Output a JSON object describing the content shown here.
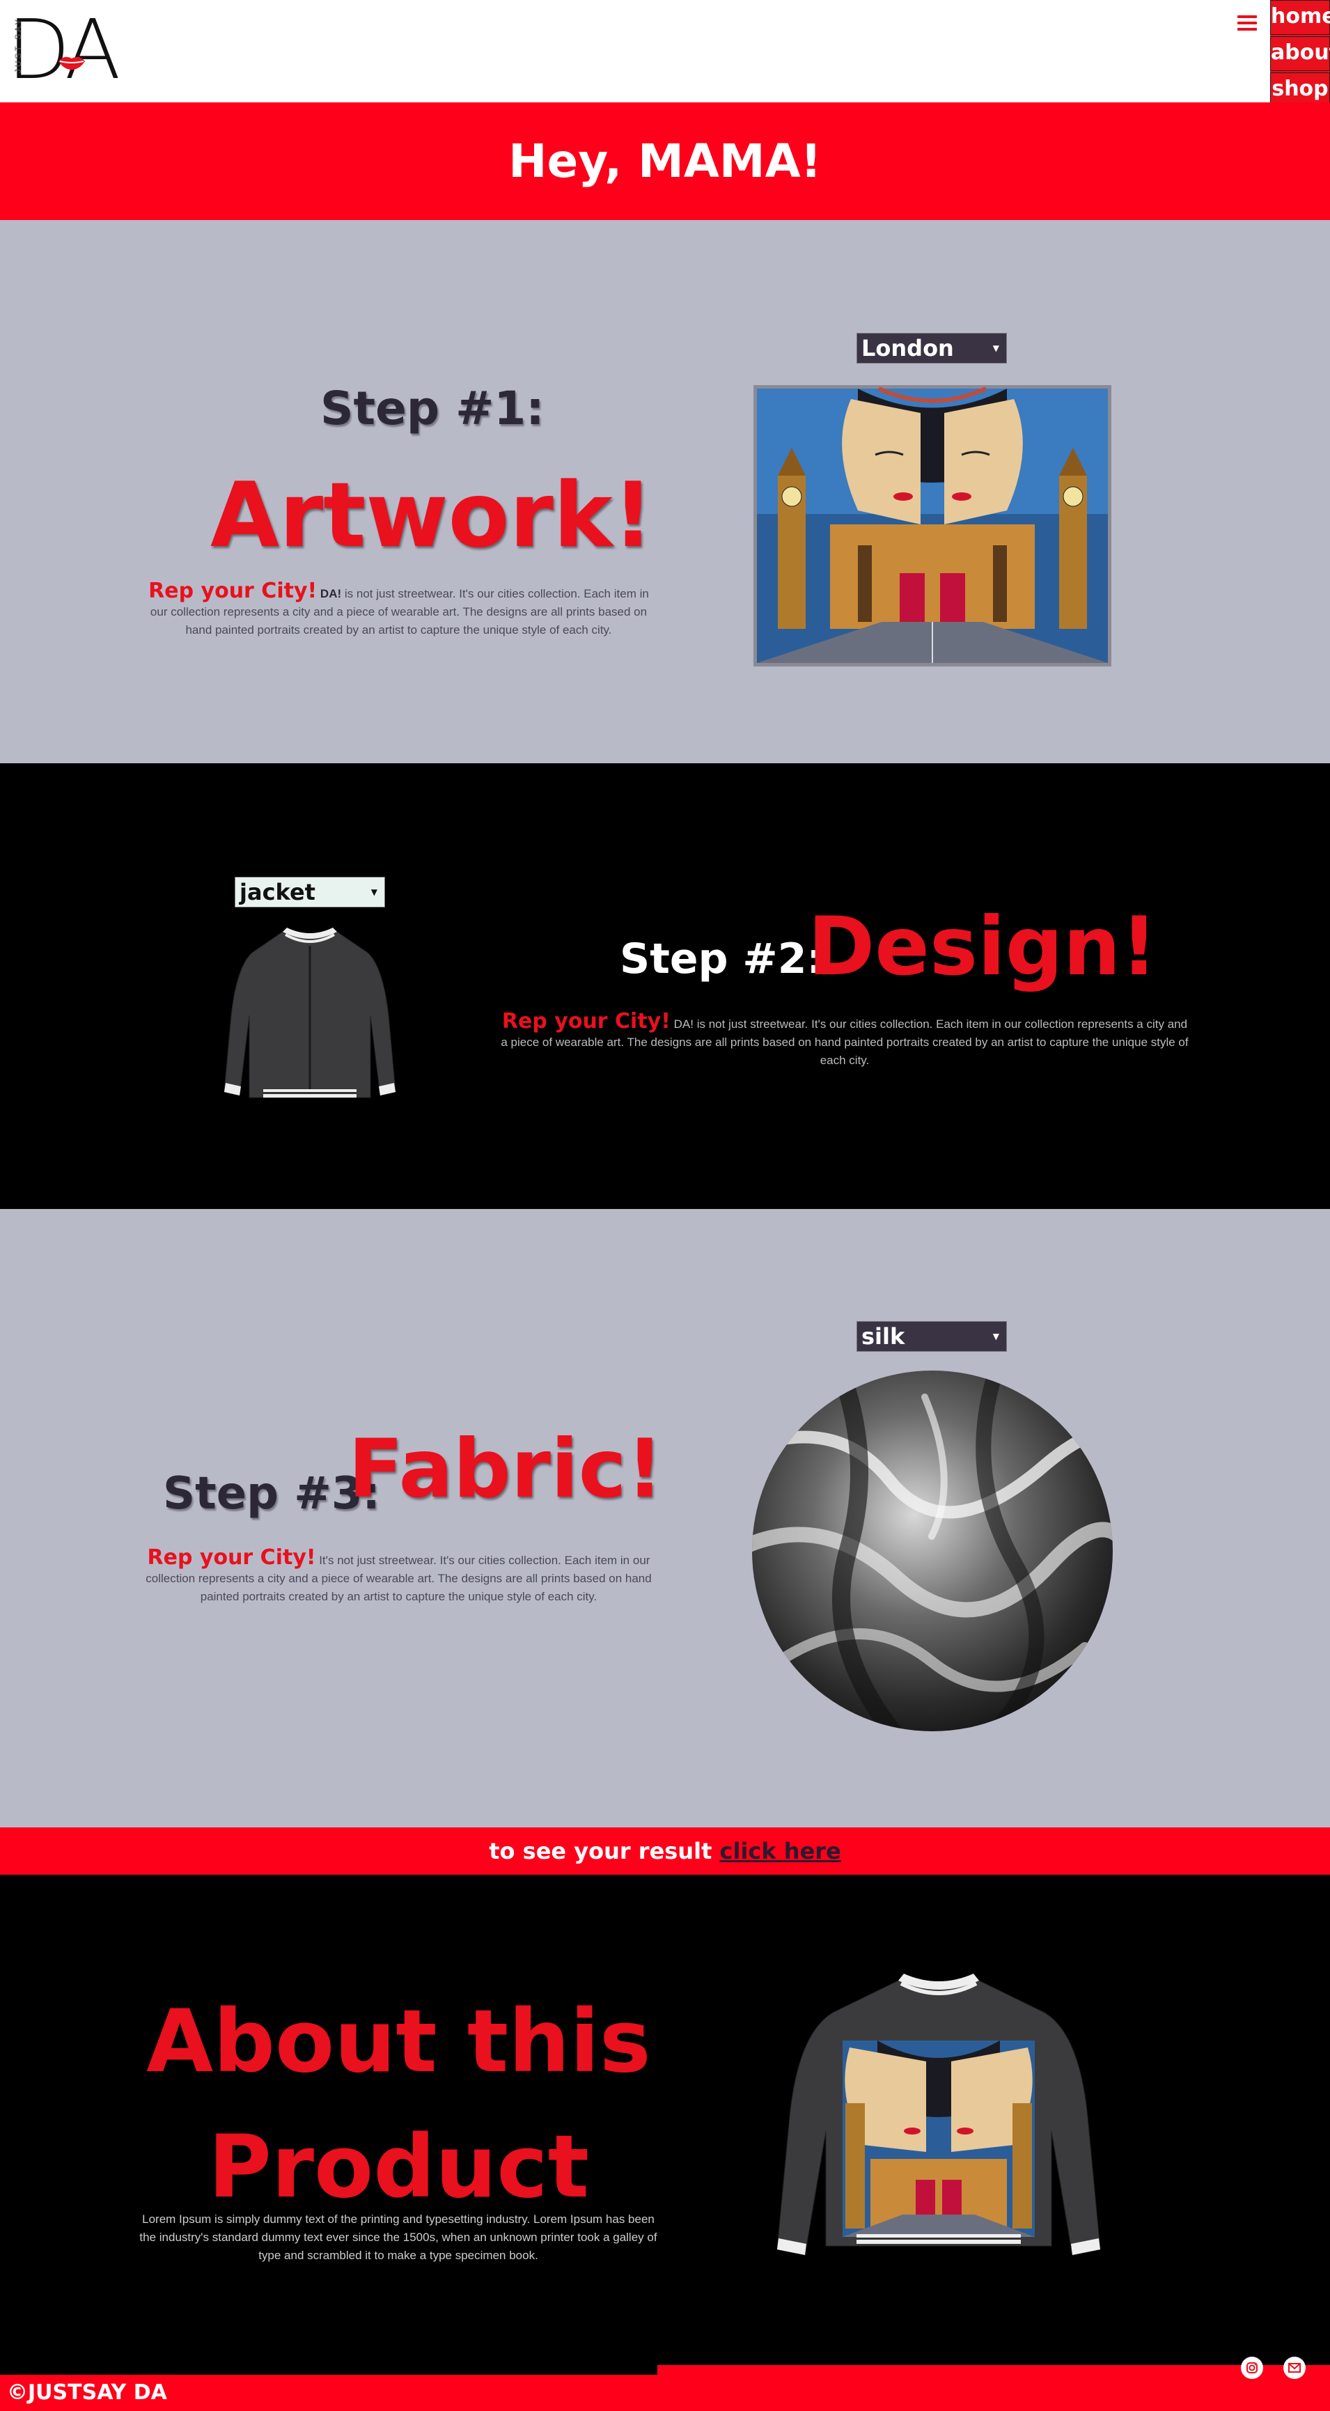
{
  "brand": {
    "logo_letters": "DA",
    "logo_tagline": "JUST SAY"
  },
  "nav": {
    "items": [
      "home",
      "about",
      "shop"
    ]
  },
  "banner": {
    "title": "Hey, MAMA!"
  },
  "step1": {
    "step": "Step #1:",
    "title": "Artwork!",
    "rep": "Rep your City!",
    "brand_bold": "DA!",
    "body": "is not just streetwear. It's our cities collection. Each item in our collection represents a city and a piece of wearable art. The designs are all prints based on hand painted portraits created by an artist to capture the unique style of each city.",
    "select_value": "London"
  },
  "step2": {
    "step": "Step #2:",
    "title": "Design!",
    "rep": "Rep your City!",
    "body": "DA! is not just streetwear. It's our cities collection. Each item in our collection represents a city and a piece of wearable art. The designs are all prints based on hand painted portraits created by an artist to capture the unique style of each city.",
    "select_value": "jacket"
  },
  "step3": {
    "step": "Step #3:",
    "title": "Fabric!",
    "rep": "Rep your City!",
    "body": "It's not just streetwear. It's our cities collection. Each item in our collection represents a city and a piece of wearable art. The designs are all prints based on hand painted portraits created by an artist to capture the unique style of each city.",
    "select_value": "silk"
  },
  "cta": {
    "text": "to see your result",
    "link": "click here"
  },
  "about": {
    "title_line1": "About this",
    "title_line2": "Product",
    "body": "Lorem Ipsum is simply dummy text of the printing and typesetting industry. Lorem Ipsum has been the industry's standard dummy text ever since the 1500s, when an unknown printer took a galley of type and scrambled it to make a type specimen book."
  },
  "footer": {
    "copyright": "©JUSTSAY DA",
    "icons": [
      "instagram-icon",
      "mail-icon"
    ]
  },
  "colors": {
    "accent_red": "#fe001a",
    "section_gray": "#b9bac8",
    "dark_select": "#3a3344"
  }
}
